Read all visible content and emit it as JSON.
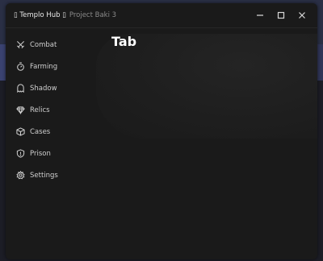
{
  "window": {
    "title": "▯ Templo Hub ▯",
    "subtitle": "Project Baki 3"
  },
  "main": {
    "tab_title": "Tab"
  },
  "sidebar": {
    "items": [
      {
        "label": "Combat",
        "icon": "swords-icon"
      },
      {
        "label": "Farming",
        "icon": "timer-icon"
      },
      {
        "label": "Shadow",
        "icon": "ghost-icon"
      },
      {
        "label": "Relics",
        "icon": "gem-icon"
      },
      {
        "label": "Cases",
        "icon": "box-icon"
      },
      {
        "label": "Prison",
        "icon": "shield-icon"
      },
      {
        "label": "Settings",
        "icon": "gear-icon"
      }
    ]
  },
  "colors": {
    "window_bg": "#1a1a1a",
    "text": "#cfcfcf",
    "title": "#ffffff"
  }
}
